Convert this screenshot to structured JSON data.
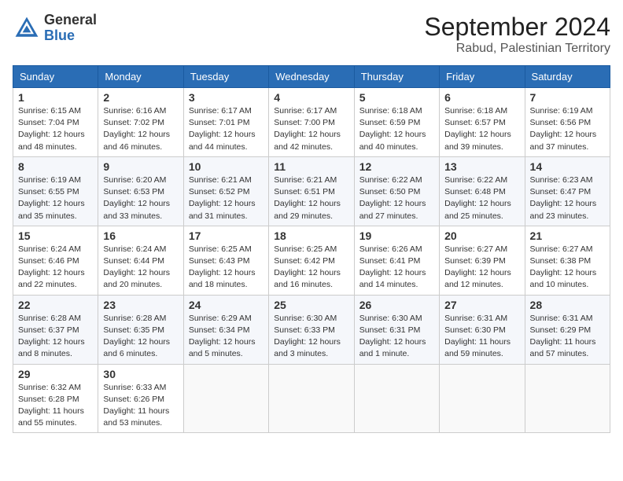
{
  "logo": {
    "general": "General",
    "blue": "Blue"
  },
  "title": "September 2024",
  "location": "Rabud, Palestinian Territory",
  "days_of_week": [
    "Sunday",
    "Monday",
    "Tuesday",
    "Wednesday",
    "Thursday",
    "Friday",
    "Saturday"
  ],
  "weeks": [
    [
      {
        "day": "1",
        "sunrise": "Sunrise: 6:15 AM",
        "sunset": "Sunset: 7:04 PM",
        "daylight": "Daylight: 12 hours and 48 minutes."
      },
      {
        "day": "2",
        "sunrise": "Sunrise: 6:16 AM",
        "sunset": "Sunset: 7:02 PM",
        "daylight": "Daylight: 12 hours and 46 minutes."
      },
      {
        "day": "3",
        "sunrise": "Sunrise: 6:17 AM",
        "sunset": "Sunset: 7:01 PM",
        "daylight": "Daylight: 12 hours and 44 minutes."
      },
      {
        "day": "4",
        "sunrise": "Sunrise: 6:17 AM",
        "sunset": "Sunset: 7:00 PM",
        "daylight": "Daylight: 12 hours and 42 minutes."
      },
      {
        "day": "5",
        "sunrise": "Sunrise: 6:18 AM",
        "sunset": "Sunset: 6:59 PM",
        "daylight": "Daylight: 12 hours and 40 minutes."
      },
      {
        "day": "6",
        "sunrise": "Sunrise: 6:18 AM",
        "sunset": "Sunset: 6:57 PM",
        "daylight": "Daylight: 12 hours and 39 minutes."
      },
      {
        "day": "7",
        "sunrise": "Sunrise: 6:19 AM",
        "sunset": "Sunset: 6:56 PM",
        "daylight": "Daylight: 12 hours and 37 minutes."
      }
    ],
    [
      {
        "day": "8",
        "sunrise": "Sunrise: 6:19 AM",
        "sunset": "Sunset: 6:55 PM",
        "daylight": "Daylight: 12 hours and 35 minutes."
      },
      {
        "day": "9",
        "sunrise": "Sunrise: 6:20 AM",
        "sunset": "Sunset: 6:53 PM",
        "daylight": "Daylight: 12 hours and 33 minutes."
      },
      {
        "day": "10",
        "sunrise": "Sunrise: 6:21 AM",
        "sunset": "Sunset: 6:52 PM",
        "daylight": "Daylight: 12 hours and 31 minutes."
      },
      {
        "day": "11",
        "sunrise": "Sunrise: 6:21 AM",
        "sunset": "Sunset: 6:51 PM",
        "daylight": "Daylight: 12 hours and 29 minutes."
      },
      {
        "day": "12",
        "sunrise": "Sunrise: 6:22 AM",
        "sunset": "Sunset: 6:50 PM",
        "daylight": "Daylight: 12 hours and 27 minutes."
      },
      {
        "day": "13",
        "sunrise": "Sunrise: 6:22 AM",
        "sunset": "Sunset: 6:48 PM",
        "daylight": "Daylight: 12 hours and 25 minutes."
      },
      {
        "day": "14",
        "sunrise": "Sunrise: 6:23 AM",
        "sunset": "Sunset: 6:47 PM",
        "daylight": "Daylight: 12 hours and 23 minutes."
      }
    ],
    [
      {
        "day": "15",
        "sunrise": "Sunrise: 6:24 AM",
        "sunset": "Sunset: 6:46 PM",
        "daylight": "Daylight: 12 hours and 22 minutes."
      },
      {
        "day": "16",
        "sunrise": "Sunrise: 6:24 AM",
        "sunset": "Sunset: 6:44 PM",
        "daylight": "Daylight: 12 hours and 20 minutes."
      },
      {
        "day": "17",
        "sunrise": "Sunrise: 6:25 AM",
        "sunset": "Sunset: 6:43 PM",
        "daylight": "Daylight: 12 hours and 18 minutes."
      },
      {
        "day": "18",
        "sunrise": "Sunrise: 6:25 AM",
        "sunset": "Sunset: 6:42 PM",
        "daylight": "Daylight: 12 hours and 16 minutes."
      },
      {
        "day": "19",
        "sunrise": "Sunrise: 6:26 AM",
        "sunset": "Sunset: 6:41 PM",
        "daylight": "Daylight: 12 hours and 14 minutes."
      },
      {
        "day": "20",
        "sunrise": "Sunrise: 6:27 AM",
        "sunset": "Sunset: 6:39 PM",
        "daylight": "Daylight: 12 hours and 12 minutes."
      },
      {
        "day": "21",
        "sunrise": "Sunrise: 6:27 AM",
        "sunset": "Sunset: 6:38 PM",
        "daylight": "Daylight: 12 hours and 10 minutes."
      }
    ],
    [
      {
        "day": "22",
        "sunrise": "Sunrise: 6:28 AM",
        "sunset": "Sunset: 6:37 PM",
        "daylight": "Daylight: 12 hours and 8 minutes."
      },
      {
        "day": "23",
        "sunrise": "Sunrise: 6:28 AM",
        "sunset": "Sunset: 6:35 PM",
        "daylight": "Daylight: 12 hours and 6 minutes."
      },
      {
        "day": "24",
        "sunrise": "Sunrise: 6:29 AM",
        "sunset": "Sunset: 6:34 PM",
        "daylight": "Daylight: 12 hours and 5 minutes."
      },
      {
        "day": "25",
        "sunrise": "Sunrise: 6:30 AM",
        "sunset": "Sunset: 6:33 PM",
        "daylight": "Daylight: 12 hours and 3 minutes."
      },
      {
        "day": "26",
        "sunrise": "Sunrise: 6:30 AM",
        "sunset": "Sunset: 6:31 PM",
        "daylight": "Daylight: 12 hours and 1 minute."
      },
      {
        "day": "27",
        "sunrise": "Sunrise: 6:31 AM",
        "sunset": "Sunset: 6:30 PM",
        "daylight": "Daylight: 11 hours and 59 minutes."
      },
      {
        "day": "28",
        "sunrise": "Sunrise: 6:31 AM",
        "sunset": "Sunset: 6:29 PM",
        "daylight": "Daylight: 11 hours and 57 minutes."
      }
    ],
    [
      {
        "day": "29",
        "sunrise": "Sunrise: 6:32 AM",
        "sunset": "Sunset: 6:28 PM",
        "daylight": "Daylight: 11 hours and 55 minutes."
      },
      {
        "day": "30",
        "sunrise": "Sunrise: 6:33 AM",
        "sunset": "Sunset: 6:26 PM",
        "daylight": "Daylight: 11 hours and 53 minutes."
      },
      null,
      null,
      null,
      null,
      null
    ]
  ]
}
